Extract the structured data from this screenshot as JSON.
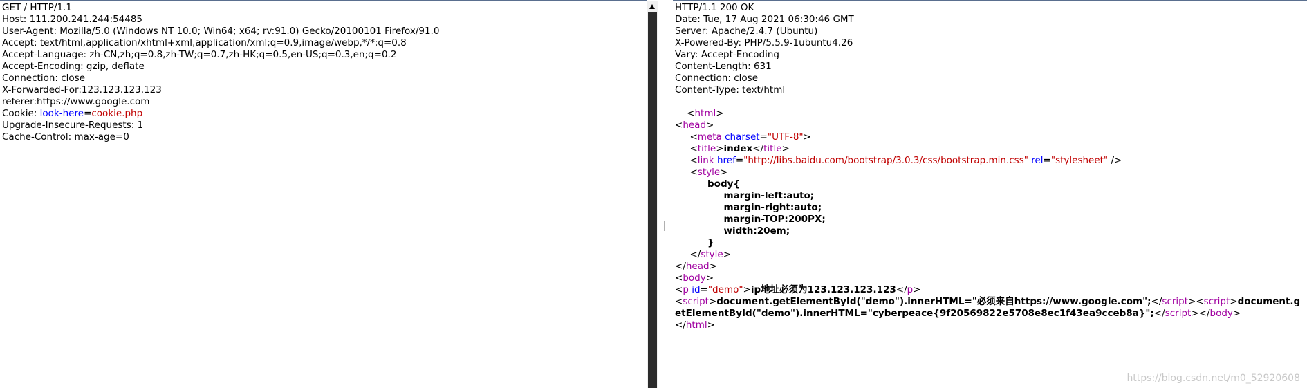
{
  "request": {
    "lines": [
      "GET / HTTP/1.1",
      "Host: 111.200.241.244:54485",
      "User-Agent: Mozilla/5.0 (Windows NT 10.0; Win64; x64; rv:91.0) Gecko/20100101 Firefox/91.0",
      "Accept: text/html,application/xhtml+xml,application/xml;q=0.9,image/webp,*/*;q=0.8",
      "Accept-Language: zh-CN,zh;q=0.8,zh-TW;q=0.7,zh-HK;q=0.5,en-US;q=0.3,en;q=0.2",
      "Accept-Encoding: gzip, deflate",
      "Connection: close",
      "X-Forwarded-For:123.123.123.123",
      "referer:https://www.google.com"
    ],
    "cookie": {
      "label": "Cookie: ",
      "name": "look-here",
      "eq": "=",
      "value": "cookie.php"
    },
    "lines_after": [
      "Upgrade-Insecure-Requests: 1",
      "Cache-Control: max-age=0"
    ]
  },
  "response": {
    "headers": [
      "HTTP/1.1 200 OK",
      "Date: Tue, 17 Aug 2021 06:30:46 GMT",
      "Server: Apache/2.4.7 (Ubuntu)",
      "X-Powered-By: PHP/5.5.9-1ubuntu4.26",
      "Vary: Accept-Encoding",
      "Content-Length: 631",
      "Connection: close",
      "Content-Type: text/html"
    ],
    "body": {
      "html_tag": "html",
      "head_tag": "head",
      "meta_tag": "meta",
      "charset_attr": "charset",
      "charset_val": "\"UTF-8\"",
      "title_tag": "title",
      "title_text": "index",
      "link_tag": "link",
      "href_attr": "href",
      "href_val": "\"http://libs.baidu.com/bootstrap/3.0.3/css/bootstrap.min.css\"",
      "rel_attr": "rel",
      "rel_val": "\"stylesheet\"",
      "style_tag": "style",
      "css_selector": "body{",
      "css_1": "margin-left:auto;",
      "css_2": "margin-right:auto;",
      "css_3": "margin-TOP:200PX;",
      "css_4": "width:20em;",
      "css_close": "}",
      "body_tag": "body",
      "p_tag": "p",
      "p_id_attr": "id",
      "p_id_val": "\"demo\"",
      "p_text": "ip地址必须为123.123.123.123",
      "script_tag": "script",
      "script1": "document.getElementById(\"demo\").innerHTML=\"必须来自https://www.google.com\";",
      "script2": "document.getElementById(\"demo\").innerHTML=\"cyberpeace{9f20569822e5708e8ec1f43ea9cceb8a}\";"
    }
  },
  "watermark": "https://blog.csdn.net/m0_52920608"
}
